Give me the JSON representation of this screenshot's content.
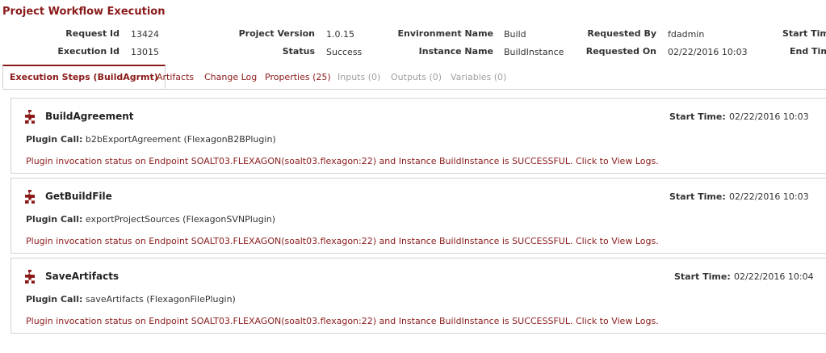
{
  "page_title": "Project Workflow Execution",
  "header": {
    "request_id_label": "Request Id",
    "request_id": "13424",
    "execution_id_label": "Execution Id",
    "execution_id": "13015",
    "project_version_label": "Project Version",
    "project_version": "1.0.15",
    "status_label": "Status",
    "status": "Success",
    "environment_name_label": "Environment Name",
    "environment_name": "Build",
    "instance_name_label": "Instance Name",
    "instance_name": "BuildInstance",
    "requested_by_label": "Requested By",
    "requested_by": "fdadmin",
    "requested_on_label": "Requested On",
    "requested_on": "02/22/2016 10:03",
    "start_time_label": "Start Time",
    "end_time_label": "End Time"
  },
  "tabs": [
    {
      "label": "Execution Steps (BuildAgrmt)",
      "state": "active"
    },
    {
      "label": "Artifacts",
      "state": "link"
    },
    {
      "label": "Change Log",
      "state": "link"
    },
    {
      "label": "Properties (25)",
      "state": "link"
    },
    {
      "label": "Inputs (0)",
      "state": "disabled"
    },
    {
      "label": "Outputs (0)",
      "state": "disabled"
    },
    {
      "label": "Variables (0)",
      "state": "disabled"
    }
  ],
  "steps": [
    {
      "name": "BuildAgreement",
      "start_time_label": "Start Time:",
      "start_time": "02/22/2016 10:03",
      "plugin_call_label": "Plugin Call:",
      "plugin_call": "b2bExportAgreement (FlexagonB2BPlugin)",
      "status_message": "Plugin invocation status on Endpoint SOALT03.FLEXAGON(soalt03.flexagon:22) and Instance BuildInstance is SUCCESSFUL. Click to View Logs."
    },
    {
      "name": "GetBuildFile",
      "start_time_label": "Start Time:",
      "start_time": "02/22/2016 10:03",
      "plugin_call_label": "Plugin Call:",
      "plugin_call": "exportProjectSources (FlexagonSVNPlugin)",
      "status_message": "Plugin invocation status on Endpoint SOALT03.FLEXAGON(soalt03.flexagon:22) and Instance BuildInstance is SUCCESSFUL. Click to View Logs."
    },
    {
      "name": "SaveArtifacts",
      "start_time_label": "Start Time:",
      "start_time": "02/22/2016 10:04",
      "plugin_call_label": "Plugin Call:",
      "plugin_call": "saveArtifacts (FlexagonFilePlugin)",
      "status_message": "Plugin invocation status on Endpoint SOALT03.FLEXAGON(soalt03.flexagon:22) and Instance BuildInstance is SUCCESSFUL. Click to View Logs."
    }
  ],
  "icons": {
    "step_icon": "puzzle-piece-icon"
  },
  "colors": {
    "accent": "#8b1a1a",
    "disabled": "#a0a0a0",
    "border": "#d4d4d4"
  }
}
